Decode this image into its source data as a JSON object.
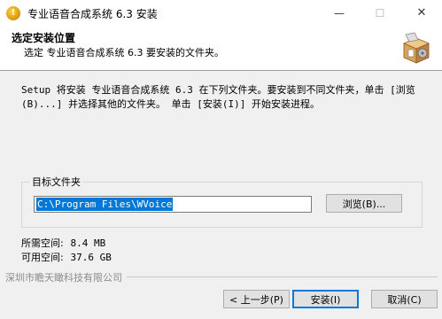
{
  "window": {
    "title": "专业语音合成系统 6.3 安装",
    "minimize_glyph": "—",
    "maximize_glyph": "☐",
    "close_glyph": "✕"
  },
  "header": {
    "title": "选定安装位置",
    "subtitle": "选定 专业语音合成系统 6.3 要安装的文件夹。",
    "icon": "installer-box-icon"
  },
  "intro_text": "Setup 将安装 专业语音合成系统 6.3 在下列文件夹。要安装到不同文件夹，单击 [浏览(B)...] 并选择其他的文件夹。 单击 [安装(I)] 开始安装进程。",
  "destination": {
    "group_label": "目标文件夹",
    "path_value": "C:\\Program Files\\WVoice",
    "browse_label": "浏览(B)..."
  },
  "space": {
    "required_label": "所需空间:",
    "required_value": "8.4 MB",
    "available_label": "可用空间:",
    "available_value": "37.6 GB"
  },
  "footer": {
    "company": "深圳市瞻天瞰科技有限公司",
    "back_label": "< 上一步(P)",
    "install_label": "安装(I)",
    "cancel_label": "取消(C)"
  },
  "colors": {
    "selection": "#0078d7",
    "window_bg": "#f0f0f0",
    "header_bg": "#ffffff"
  }
}
